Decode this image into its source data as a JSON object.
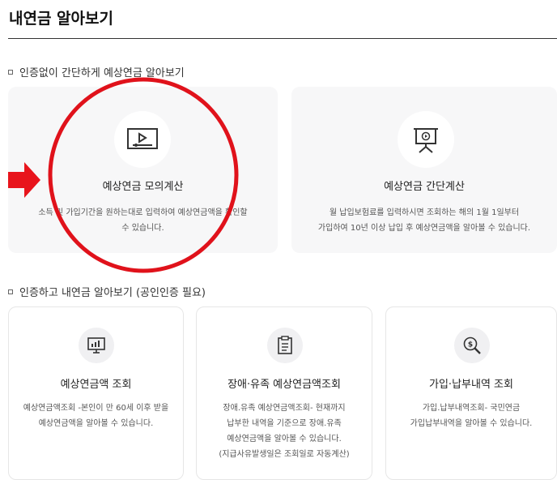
{
  "page": {
    "title": "내연금 알아보기"
  },
  "section1": {
    "heading": "인증없이 간단하게 예상연금 알아보기",
    "cards": [
      {
        "title": "예상연금 모의계산",
        "desc_line1": "소득 및 가입기간을 원하는대로 입력하여 예상연금액을 확인할",
        "desc_line2": "수 있습니다.",
        "icon": "video-screen-icon"
      },
      {
        "title": "예상연금 간단계산",
        "desc_line1": "월 납입보험료를 입력하시면 조회하는 해의 1월 1일부터",
        "desc_line2": "가입하여 10년 이상 납입 후 예상연금액을 알아볼 수 있습니다.",
        "icon": "presentation-board-icon"
      }
    ]
  },
  "section2": {
    "heading": "인증하고 내연금 알아보기 (공인인증 필요)",
    "cards": [
      {
        "title": "예상연금액 조회",
        "desc_line1": "예상연금액조회 -본인이 만 60세 이후 받을",
        "desc_line2": "예상연금액을 알아볼 수 있습니다.",
        "icon": "monitor-chart-icon"
      },
      {
        "title": "장애·유족 예상연금액조회",
        "desc_line1": "장애.유족 예상연금액조회- 현재까지",
        "desc_line2": "납부한 내역을 기준으로 장애.유족",
        "desc_line3": "예상연금액을 알아볼 수 있습니다.",
        "desc_line4": "(지급사유발생일은 조회일로 자동계산)",
        "icon": "clipboard-icon"
      },
      {
        "title": "가입·납부내역 조회",
        "desc_line1": "가입.납부내역조회- 국민연금",
        "desc_line2": "가입납부내역을 알아볼 수 있습니다.",
        "icon": "dollar-search-icon"
      }
    ]
  },
  "annotation": {
    "arrow_color": "#e8141c",
    "circle_color": "#e0121b"
  }
}
